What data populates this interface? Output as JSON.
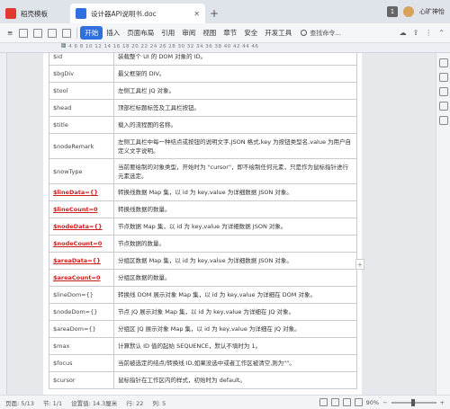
{
  "tabs": [
    {
      "label": "稻壳模板",
      "icon": "docer-icon"
    },
    {
      "label": "设计器API说明书.doc",
      "icon": "word-doc-icon"
    }
  ],
  "titlebar": {
    "badge": "1",
    "username": "心旷神怡"
  },
  "menu": {
    "items": [
      "开始",
      "插入",
      "页面布局",
      "引用",
      "审阅",
      "视图",
      "章节",
      "安全",
      "开发工具"
    ],
    "search": "查找命令..."
  },
  "ruler": {
    "numbers": "2  4  6  8  10  12  14  16  18  20  22  24  26  28  30  32  34  36  38  40  42  44  46"
  },
  "table": {
    "rows": [
      {
        "key": "$id",
        "desc": "装载整个 UI 的 DOM 对象的 ID。",
        "red": false
      },
      {
        "key": "$bgDiv",
        "desc": "最父框架的 DIV。",
        "red": false
      },
      {
        "key": "$tool",
        "desc": "左侧工具栏 JQ 对象。",
        "red": false
      },
      {
        "key": "$head",
        "desc": "顶部栏标题标签及工具栏按钮。",
        "red": false
      },
      {
        "key": "$title",
        "desc": "载入的流程图的名称。",
        "red": false
      },
      {
        "key": "$nodeRemark",
        "desc": "左侧工具栏中每一种结点或按钮的说明文字,JSON 格式,key 为按钮类型名,value 为用户自定义文字说明。",
        "red": false
      },
      {
        "key": "$nowType",
        "desc": "当前要绘制的对象类型，开始时为 \"cursor\"，即不绘制任何元素，只是作为鼠标指针进行元素选定。",
        "red": false
      },
      {
        "key": "$lineData={}",
        "desc": "转换线数据 Map 集，以 id 为 key,value 为详细数据 JSON 对象。",
        "red": true
      },
      {
        "key": "$lineCount=0",
        "desc": "转换线数据的数量。",
        "red": true
      },
      {
        "key": "$nodeData={}",
        "desc": "节点数据 Map 集，以 id 为 key,value 为详细数据 JSON 对象。",
        "red": true
      },
      {
        "key": "$nodeCount=0",
        "desc": "节点数据的数量。",
        "red": true
      },
      {
        "key": "$areaData={}",
        "desc": "分组区数据 Map 集，以 id 为 key,value 为详细数据 JSON 对象。",
        "red": true
      },
      {
        "key": "$areaCount=0",
        "desc": "分组区数据的数量。",
        "red": true
      },
      {
        "key": "$lineDom={}",
        "desc": "转换线 DOM 展示对象 Map 集，以 id 为 key,value 为详细在 DOM 对象。",
        "red": false
      },
      {
        "key": "$nodeDom={}",
        "desc": "节点 JQ 展示对象 Map 集，以 id 为 key,value 为详细在 JQ 对象。",
        "red": false
      },
      {
        "key": "$areaDom={}",
        "desc": "分组区 JQ 展示对象 Map 集，以 id 为 key,value 为详细在 JQ 对象。",
        "red": false
      },
      {
        "key": "$max",
        "desc": "计算默认 ID 值的起始 SEQUENCE，默认不填时为 1。",
        "red": false
      },
      {
        "key": "$focus",
        "desc": "当前被选定的结点/转换线 ID,如果没选中或者工作区被清空,则为\"\"。",
        "red": false
      },
      {
        "key": "$cursor",
        "desc": "鼠标指针在工作区内的样式，初始时为 default。",
        "red": false
      }
    ]
  },
  "status": {
    "page": "页面: 5/13",
    "section": "节: 1/1",
    "setvalue": "设置值: 14.3厘米",
    "row": "行: 22",
    "col": "列: 5",
    "zoom": "90%"
  }
}
